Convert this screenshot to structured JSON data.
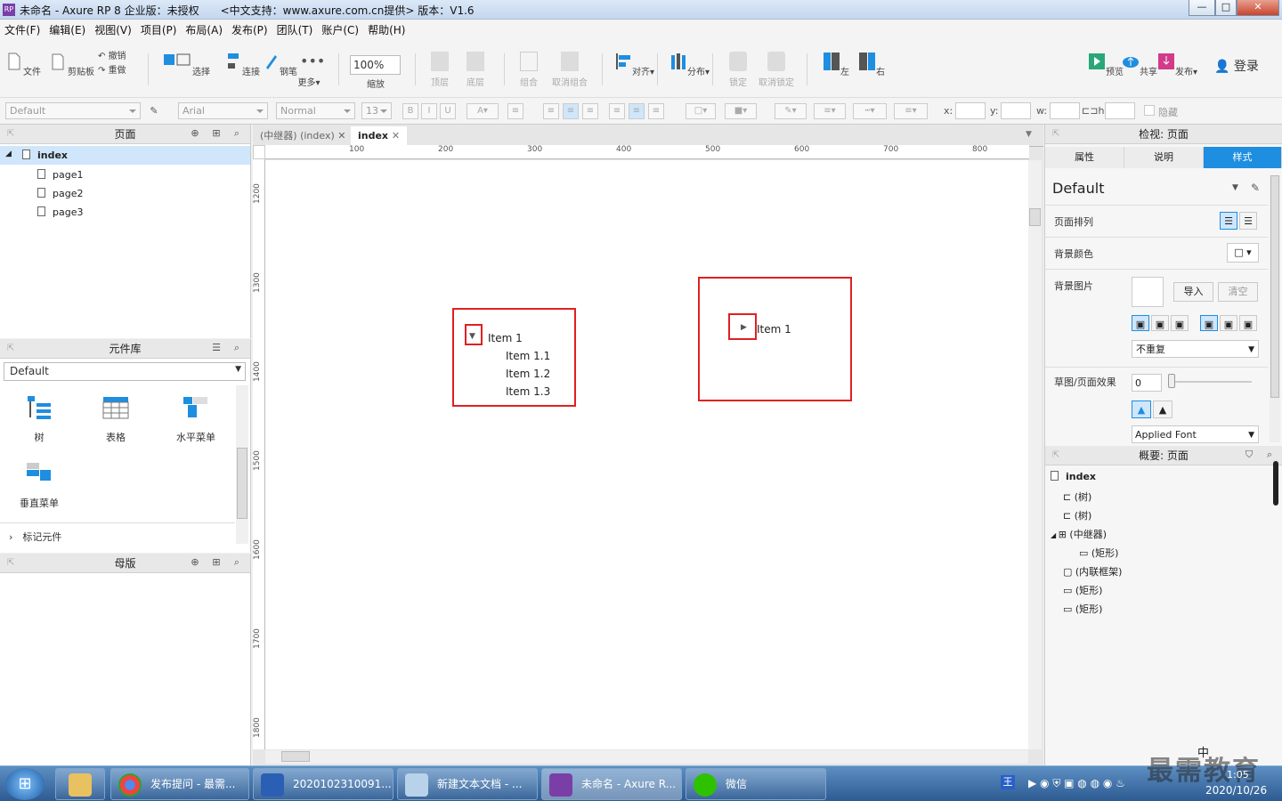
{
  "window": {
    "title": "未命名 - Axure RP 8 企业版：未授权　　<中文支持：www.axure.com.cn提供> 版本：V1.6",
    "logo": "RP",
    "controls": [
      "—",
      "□",
      "✕"
    ]
  },
  "menu": [
    "文件(F)",
    "编辑(E)",
    "视图(V)",
    "项目(P)",
    "布局(A)",
    "发布(P)",
    "团队(T)",
    "账户(C)",
    "帮助(H)"
  ],
  "toolbar": {
    "file": "文件",
    "clipboard": "剪贴板",
    "undo": "撤销",
    "redo": "重做",
    "select": "选择",
    "connect": "连接",
    "pen": "钢笔",
    "more": "更多▾",
    "zoom_value": "100%",
    "zoom_label": "缩放",
    "top": "顶层",
    "bottom": "底层",
    "group": "组合",
    "ungroup": "取消组合",
    "align": "对齐▾",
    "distribute": "分布▾",
    "lock": "锁定",
    "unlock": "取消锁定",
    "left": "左",
    "right": "右",
    "preview": "预览",
    "share": "共享",
    "publish": "发布▾",
    "login": "登录"
  },
  "format": {
    "style": "Default",
    "font": "Arial",
    "weight": "Normal",
    "size": "13",
    "x": "x:",
    "y": "y:",
    "w": "w:",
    "h": "h:",
    "hide": "隐藏"
  },
  "pages_panel": {
    "title": "页面",
    "root": "index",
    "children": [
      "page1",
      "page2",
      "page3"
    ]
  },
  "library_panel": {
    "title": "元件库",
    "selected": "Default",
    "widgets": [
      "树",
      "表格",
      "水平菜单",
      "垂直菜单"
    ],
    "footer": "标记元件"
  },
  "masters_panel": {
    "title": "母版"
  },
  "tabs": [
    {
      "label": "(中继器) (index)"
    },
    {
      "label": "index"
    }
  ],
  "ruler_h": [
    "100",
    "200",
    "300",
    "400",
    "500",
    "600",
    "700",
    "800"
  ],
  "ruler_v": [
    "1200",
    "1300",
    "1400",
    "1500",
    "1600",
    "1700",
    "1800"
  ],
  "canvas": {
    "tree1": {
      "root": "Item 1",
      "children": [
        "Item 1.1",
        "Item 1.2",
        "Item 1.3"
      ]
    },
    "tree2": {
      "root": "Item 1"
    }
  },
  "inspector": {
    "title": "检视: 页面",
    "tabs": [
      "属性",
      "说明",
      "样式"
    ],
    "style_name": "Default",
    "page_align": "页面排列",
    "bg_color": "背景颜色",
    "bg_image": "背景图片",
    "import": "导入",
    "clear": "清空",
    "repeat": "不重复",
    "sketch": "草图/页面效果",
    "sketch_value": "0",
    "font": "Applied Font"
  },
  "outline": {
    "title": "概要: 页面",
    "items": [
      "index",
      "(树)",
      "(树)",
      "(中继器)",
      "(矩形)",
      "(内联框架)",
      "(矩形)",
      "(矩形)"
    ]
  },
  "taskbar": {
    "items": [
      "发布提问 - 最需...",
      "2020102310091...",
      "新建文本文档 - ...",
      "未命名 - Axure R...",
      "微信"
    ],
    "clock": "2020/10/26",
    "time": "1:05",
    "watermark": "最需教育",
    "ime": "中"
  },
  "colors": {
    "accent": "#1e8ee0",
    "red": "#e02020",
    "tab_active": "#1e8ee0"
  }
}
